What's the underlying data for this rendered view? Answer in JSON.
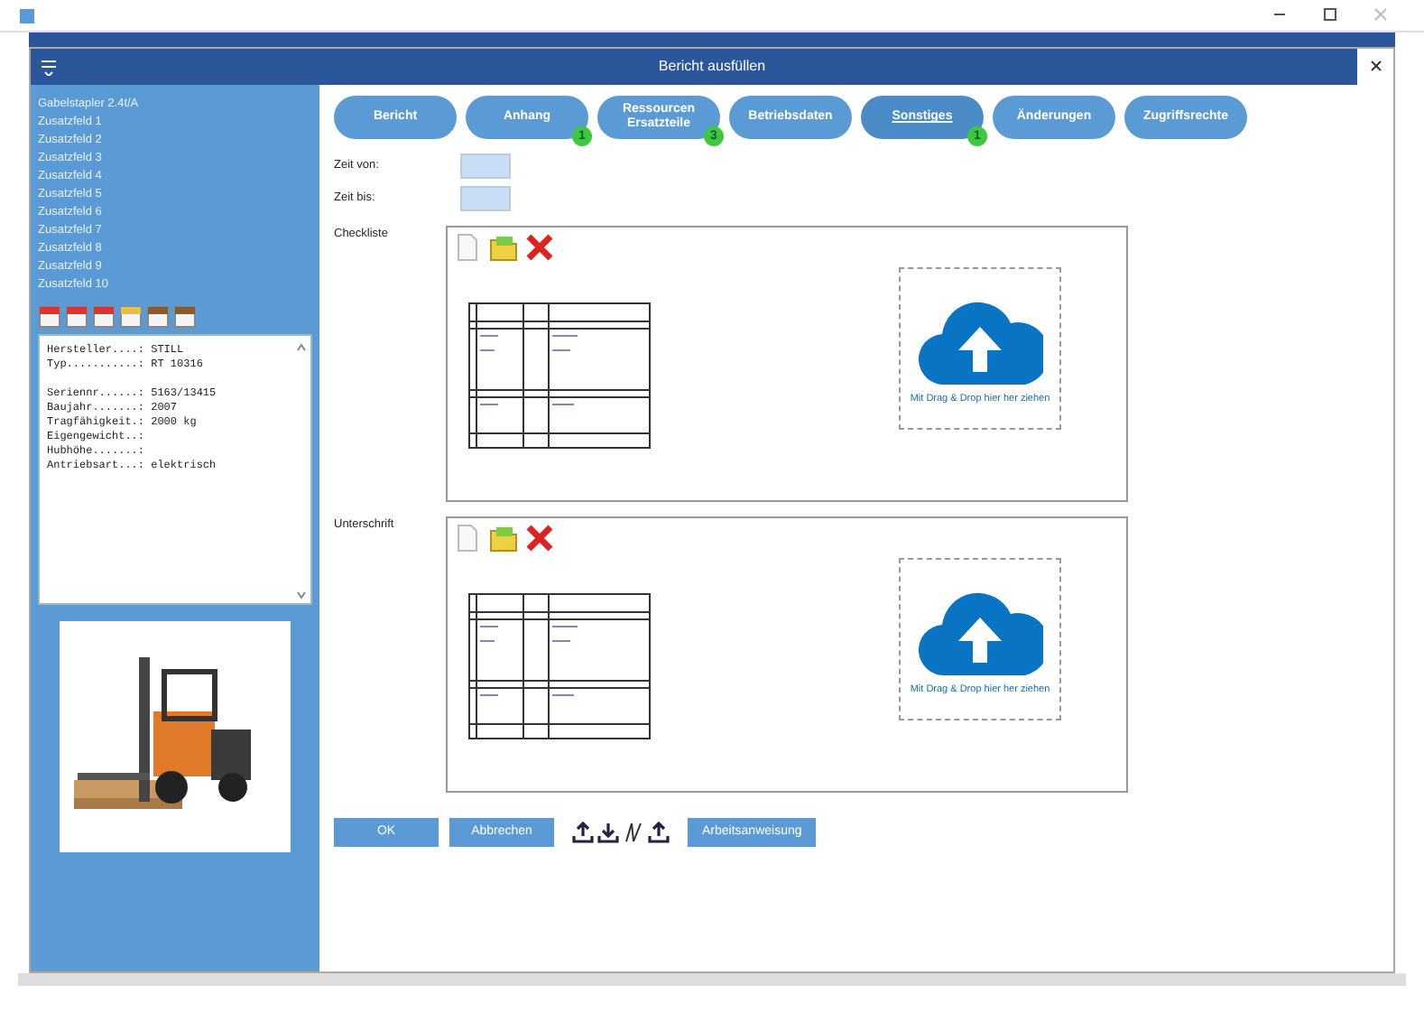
{
  "dialog": {
    "title": "Bericht ausfüllen"
  },
  "sidebar": {
    "heading": "Gabelstapler 2.4t/A",
    "fields": [
      {
        "label": "Zusatzfeld 1"
      },
      {
        "label": "Zusatzfeld 2"
      },
      {
        "label": "Zusatzfeld 3"
      },
      {
        "label": "Zusatzfeld 4"
      },
      {
        "label": "Zusatzfeld 5"
      },
      {
        "label": "Zusatzfeld 6"
      },
      {
        "label": "Zusatzfeld 7"
      },
      {
        "label": "Zusatzfeld 8"
      },
      {
        "label": "Zusatzfeld 9"
      },
      {
        "label": "Zusatzfeld 10"
      }
    ],
    "details": [
      {
        "kind": "line",
        "label": "Hersteller....:",
        "value": "STILL"
      },
      {
        "kind": "line",
        "label": "Typ...........:",
        "value": "RT 10316"
      },
      {
        "kind": "blank"
      },
      {
        "kind": "line",
        "label": "Seriennr......:",
        "value": "5163/13415"
      },
      {
        "kind": "line",
        "label": "Baujahr.......:",
        "value": "2007"
      },
      {
        "kind": "line",
        "label": "Tragfähigkeit.:",
        "value": "2000 kg"
      },
      {
        "kind": "line",
        "label": "Eigengewicht..:"
      },
      {
        "kind": "line",
        "label": "Hubhöhe.......:"
      },
      {
        "kind": "line",
        "label": "Antriebsart...:",
        "value": "elektrisch"
      }
    ]
  },
  "tabs": [
    {
      "label": "Bericht",
      "selected": false
    },
    {
      "label": "Anhang",
      "badge": "1",
      "selected": false
    },
    {
      "label": "Ressourcen Ersatzteile",
      "badge": "3",
      "selected": false
    },
    {
      "label": "Betriebsdaten",
      "selected": false
    },
    {
      "label": "Sonstiges",
      "badge": "1",
      "selected": true
    },
    {
      "label": "Änderungen",
      "selected": false
    },
    {
      "label": "Zugriffsrechte",
      "selected": false
    }
  ],
  "time_fields": [
    {
      "label": "Zeit von:"
    },
    {
      "label": "Zeit bis:"
    }
  ],
  "attachments": [
    {
      "label": "Checkliste",
      "dropzone_text": "Mit Drag & Drop hier her ziehen"
    },
    {
      "label": "Unterschrift",
      "dropzone_text": "Mit Drag & Drop hier her ziehen"
    }
  ],
  "buttons": [
    {
      "kind": "button",
      "label": "OK"
    },
    {
      "kind": "button",
      "label": "Abbrechen"
    },
    {
      "kind": "icons"
    },
    {
      "kind": "button",
      "label": "Arbeitsanweisung"
    }
  ]
}
